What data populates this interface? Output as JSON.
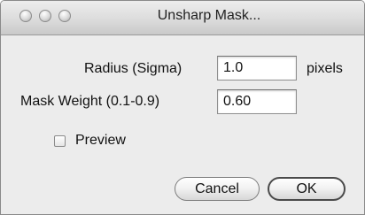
{
  "window": {
    "title": "Unsharp Mask..."
  },
  "form": {
    "radius_label": "Radius (Sigma)",
    "radius_value": "1.0",
    "radius_unit": "pixels",
    "weight_label": "Mask Weight (0.1-0.9)",
    "weight_value": "0.60",
    "preview_label": "Preview",
    "preview_checked": false
  },
  "buttons": {
    "cancel": "Cancel",
    "ok": "OK"
  }
}
